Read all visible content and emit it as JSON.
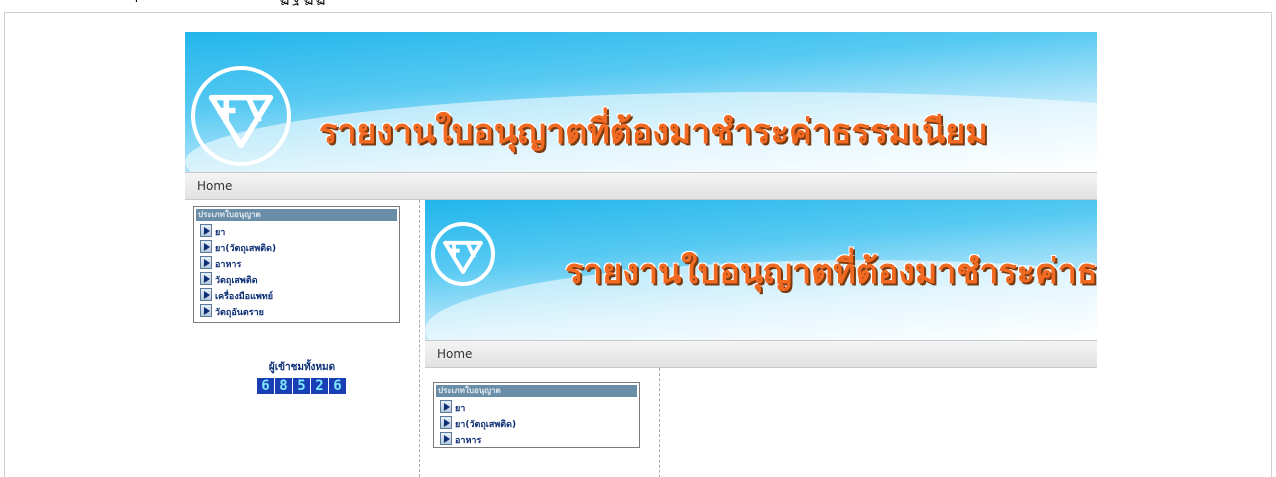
{
  "browser_strip": {
    "glyphs": [
      "ฯ",
      "ฏ",
      "ฐ",
      "ฏ",
      "ฏ",
      "ฐ",
      "ฏ"
    ]
  },
  "banner": {
    "title": "รายงานใบอนุญาตที่ต้องมาชำระค่าธรรมเนียม",
    "logo_icon": "fda-circle-logo-icon"
  },
  "navbar": {
    "home_label": "Home"
  },
  "sidebar": {
    "menu_title": "ประเภทใบอนุญาต",
    "items": [
      {
        "label": "ยา"
      },
      {
        "label": "ยา(วัตถุเสพติด)"
      },
      {
        "label": "อาหาร"
      },
      {
        "label": "วัตถุเสพติด"
      },
      {
        "label": "เครื่องมือแพทย์"
      },
      {
        "label": "วัตถุอันตราย"
      }
    ],
    "counter_label": "ผู้เข้าชมทั้งหมด",
    "counter_digits": [
      "6",
      "8",
      "5",
      "2",
      "6"
    ]
  },
  "colors": {
    "banner_title": "#f26a21",
    "menu_text": "#0d2f75",
    "counter_bg": "#1a3fb5",
    "counter_fg": "#7ee7ff"
  }
}
